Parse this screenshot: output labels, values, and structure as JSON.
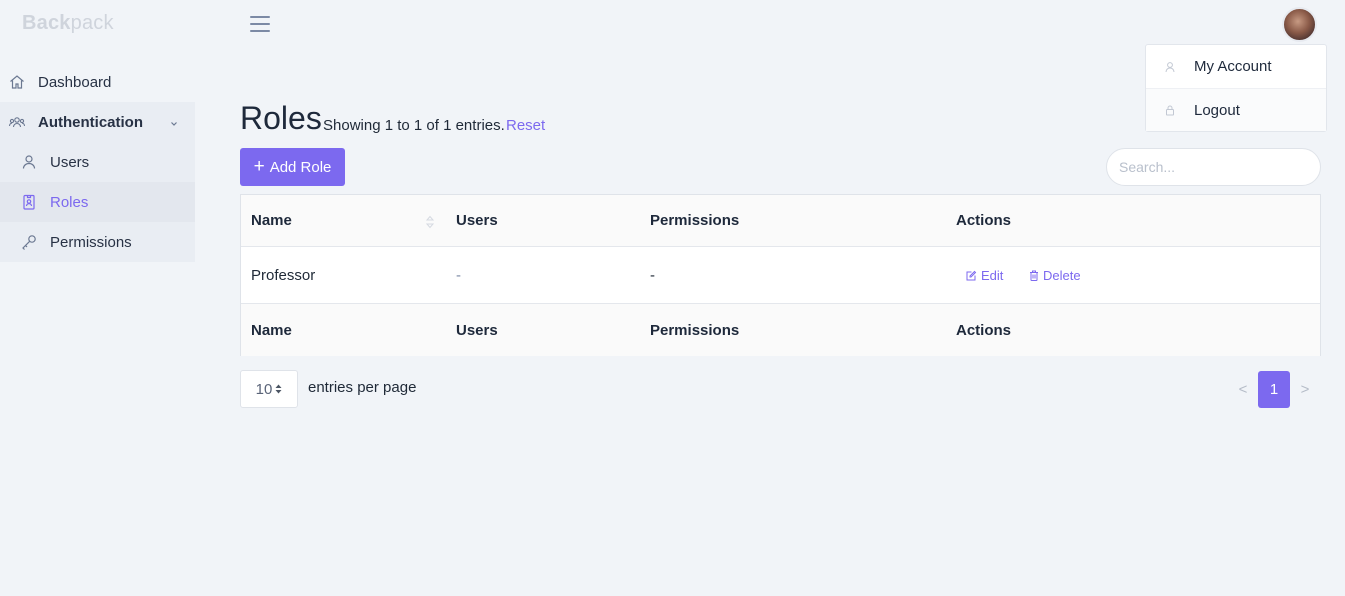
{
  "brand": {
    "bold": "Back",
    "light": "pack"
  },
  "user_menu": {
    "items": [
      {
        "label": "My Account",
        "icon": "user-icon"
      },
      {
        "label": "Logout",
        "icon": "lock-icon"
      }
    ]
  },
  "sidebar": {
    "dashboard": "Dashboard",
    "authentication": "Authentication",
    "users": "Users",
    "roles": "Roles",
    "permissions": "Permissions"
  },
  "page": {
    "title": "Roles",
    "entries_info": "Showing 1 to 1 of 1 entries.",
    "reset": "Reset",
    "add_button": "Add Role",
    "search_placeholder": "Search..."
  },
  "table": {
    "columns": [
      "Name",
      "Users",
      "Permissions",
      "Actions"
    ],
    "rows": [
      {
        "name": "Professor",
        "users": "-",
        "permissions": "-",
        "edit": "Edit",
        "delete": "Delete"
      }
    ]
  },
  "pagination": {
    "per_page": "10",
    "per_page_label": "entries per page",
    "prev": "<",
    "current": "1",
    "next": ">"
  },
  "colors": {
    "accent": "#7c69ef",
    "background": "#f1f4f8"
  }
}
